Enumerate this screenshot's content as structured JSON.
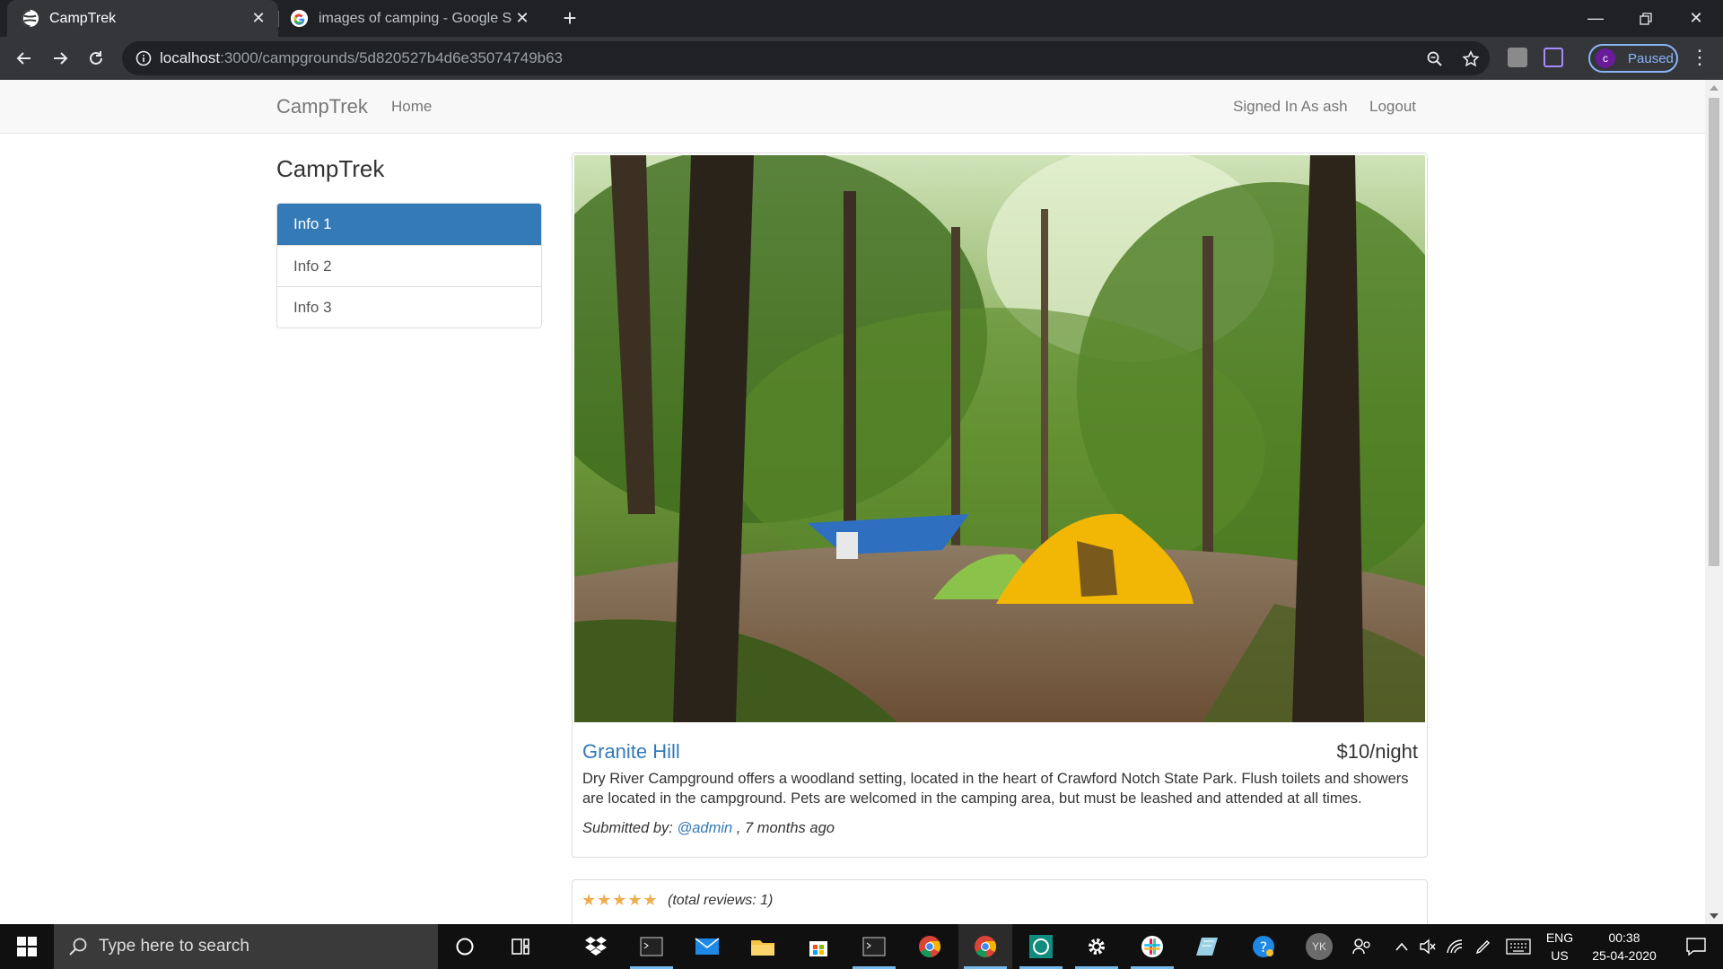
{
  "browser": {
    "tabs": [
      {
        "title": "CampTrek",
        "active": true
      },
      {
        "title": "images of camping - Google Sea",
        "active": false
      }
    ],
    "url_host": "localhost",
    "url_path": ":3000/campgrounds/5d820527b4d6e35074749b63",
    "profile_initial": "c",
    "profile_status": "Paused"
  },
  "site": {
    "brand": "CampTrek",
    "nav_home": "Home",
    "signed_in": "Signed In As ash",
    "logout": "Logout"
  },
  "sidebar": {
    "title": "CampTrek",
    "items": [
      {
        "label": "Info 1",
        "active": true
      },
      {
        "label": "Info 2",
        "active": false
      },
      {
        "label": "Info 3",
        "active": false
      }
    ]
  },
  "campground": {
    "name": "Granite Hill",
    "price": "$10/night",
    "description": "Dry River Campground offers a woodland setting, located in the heart of Crawford Notch State Park. Flush toilets and showers are located in the campground. Pets are welcomed in the camping area, but must be leashed and attended at all times.",
    "submitted_prefix": "Submitted by: ",
    "author": "@admin",
    "submitted_suffix": " , 7 months ago"
  },
  "reviews": {
    "stars": "★★★★★",
    "total_text": "(total reviews: 1)"
  },
  "taskbar": {
    "search_placeholder": "Type here to search",
    "lang_line1": "ENG",
    "lang_line2": "US",
    "time": "00:38",
    "date": "25-04-2020",
    "avatar_initials": "YK"
  },
  "colors": {
    "accent": "#337ab7",
    "star": "#f0ad4e",
    "chrome_dark": "#202124",
    "chrome_toolbar": "#35363a"
  }
}
